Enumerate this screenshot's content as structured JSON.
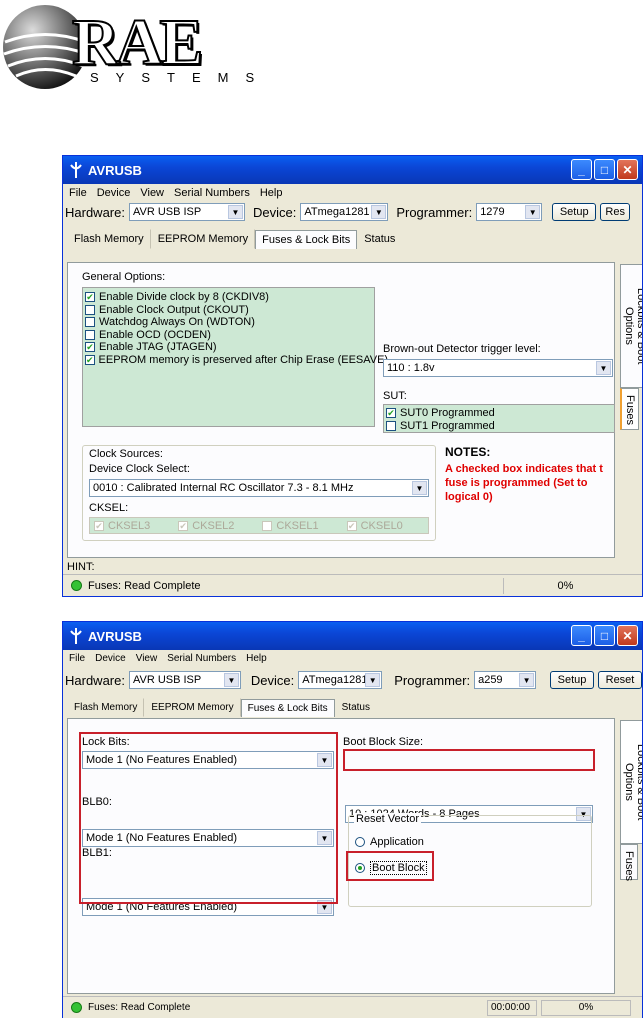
{
  "logo": {
    "word": "RAE",
    "sub": "SYSTEMS"
  },
  "w1": {
    "title": "AVRUSB",
    "menu": [
      "File",
      "Device",
      "View",
      "Serial Numbers",
      "Help"
    ],
    "hw_label": "Hardware:",
    "hw_value": "AVR USB ISP",
    "dev_label": "Device:",
    "dev_value": "ATmega1281",
    "prog_label": "Programmer:",
    "prog_value": "1279",
    "setup": "Setup",
    "reset": "Res",
    "tabs": [
      "Flash Memory",
      "EEPROM Memory",
      "Fuses & Lock Bits",
      "Status"
    ],
    "general_title": "General Options:",
    "options": [
      {
        "label": "Enable Divide clock by 8 (CKDIV8)",
        "checked": true
      },
      {
        "label": "Enable Clock Output (CKOUT)",
        "checked": false
      },
      {
        "label": "Watchdog Always On (WDTON)",
        "checked": false
      },
      {
        "label": "Enable OCD (OCDEN)",
        "checked": false
      },
      {
        "label": "Enable JTAG (JTAGEN)",
        "checked": true
      },
      {
        "label": "EEPROM memory is preserved after Chip Erase (EESAVE)",
        "checked": true
      }
    ],
    "bod_label": "Brown-out Detector trigger level:",
    "bod_value": "110 : 1.8v",
    "sut_label": "SUT:",
    "sut0": "SUT0 Programmed",
    "sut1": "SUT1 Programmed",
    "clock_title": "Clock Sources:",
    "dcs_label": "Device Clock Select:",
    "dcs_value": "0010 : Calibrated Internal RC Oscillator 7.3 - 8.1 MHz",
    "cksel_label": "CKSEL:",
    "cksel": [
      {
        "label": "CKSEL3",
        "checked": true
      },
      {
        "label": "CKSEL2",
        "checked": true
      },
      {
        "label": "CKSEL1",
        "checked": false
      },
      {
        "label": "CKSEL0",
        "checked": true
      }
    ],
    "notes_title": "NOTES:",
    "notes_l1": "A checked box indicates that t",
    "notes_l2": "fuse is programmed (Set to",
    "notes_l3": "logical 0)",
    "vtab1": "Lockbits & Boot Options",
    "vtab2": "Fuses",
    "hint": "HINT:",
    "status": "Fuses: Read Complete",
    "pct": "0%"
  },
  "w2": {
    "title": "AVRUSB",
    "menu": [
      "File",
      "Device",
      "View",
      "Serial Numbers",
      "Help"
    ],
    "hw_label": "Hardware:",
    "hw_value": "AVR USB ISP",
    "dev_label": "Device:",
    "dev_value": "ATmega1281",
    "prog_label": "Programmer:",
    "prog_value": "a259",
    "setup": "Setup",
    "reset": "Reset",
    "tabs": [
      "Flash Memory",
      "EEPROM Memory",
      "Fuses & Lock Bits",
      "Status"
    ],
    "lock_label": "Lock Bits:",
    "lock_value": "Mode 1 (No Features Enabled)",
    "bld0_label": "BLB0:",
    "bld0_value": "Mode 1 (No Features Enabled)",
    "blb1_label": "BLB1:",
    "blb1_value": "Mode 1 (No Features Enabled)",
    "bbs_label": "Boot Block Size:",
    "bbs_value": "10 : 1024 Words - 8 Pages",
    "rv_title": "Reset Vector",
    "rv_app": "Application",
    "rv_boot": "Boot Block",
    "vtab1": "Lockbits & Boot Options",
    "vtab2": "Fuses",
    "status": "Fuses: Read Complete",
    "time": "00:00:00",
    "pct": "0%"
  }
}
